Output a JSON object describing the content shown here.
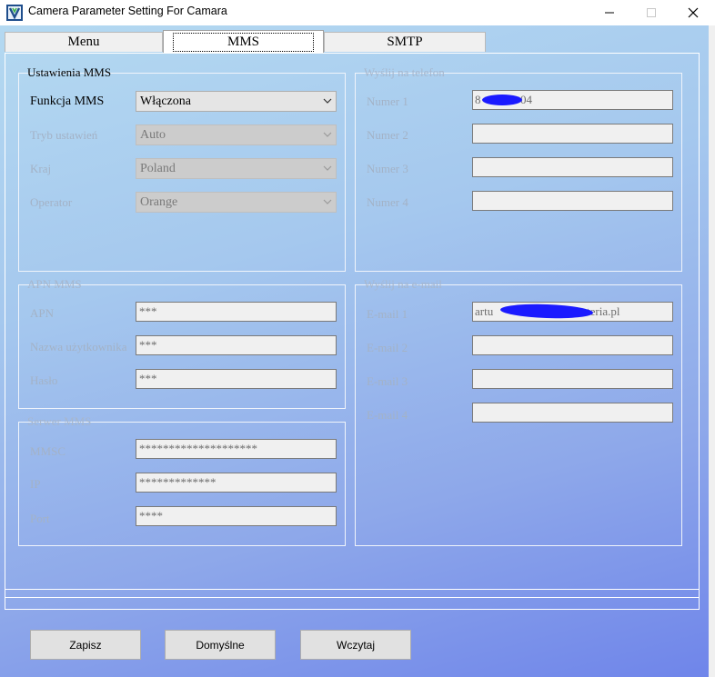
{
  "window": {
    "title": "Camera Parameter Setting For  Camara",
    "icon": "app-logo-icon"
  },
  "tabs": [
    {
      "label": "Menu",
      "active": false
    },
    {
      "label": "MMS",
      "active": true
    },
    {
      "label": "SMTP",
      "active": false
    }
  ],
  "ustawienia": {
    "title": "Ustawienia MMS",
    "funkcja_label": "Funkcja MMS",
    "funkcja_value": "Włączona",
    "tryb_label": "Tryb ustawień",
    "tryb_value": "Auto",
    "kraj_label": "Kraj",
    "kraj_value": "Poland",
    "operator_label": "Operator",
    "operator_value": "Orange"
  },
  "apn": {
    "title": "APN MMS",
    "apn_label": "APN",
    "apn_value": "***",
    "user_label": "Nazwa użytkownika",
    "user_value": "***",
    "pass_label": "Hasło",
    "pass_value": "***"
  },
  "serwer": {
    "title": "Serwer MMS",
    "mmsc_label": "MMSC",
    "mmsc_value": "********************",
    "ip_label": "IP",
    "ip_value": "*************",
    "port_label": "Port",
    "port_value": "****"
  },
  "telefon": {
    "title": "Wyślij na telefon",
    "numer1_label": "Numer 1",
    "numer1_prefix": "8",
    "numer1_suffix": "04",
    "numer2_label": "Numer 2",
    "numer3_label": "Numer 3",
    "numer4_label": "Numer 4"
  },
  "email": {
    "title": "Wyślij na e-mail",
    "email1_label": "E-mail 1",
    "email1_prefix": "artu",
    "email1_suffix": "teria.pl",
    "email2_label": "E-mail 2",
    "email3_label": "E-mail 3",
    "email4_label": "E-mail 4"
  },
  "buttons": {
    "zapisz": "Zapisz",
    "domyslne": "Domyślne",
    "wczytaj": "Wczytaj"
  },
  "colors": {
    "redaction": "#1a1aff",
    "gradient_top": "#b4d9f1",
    "gradient_bottom": "#6f85ea"
  }
}
